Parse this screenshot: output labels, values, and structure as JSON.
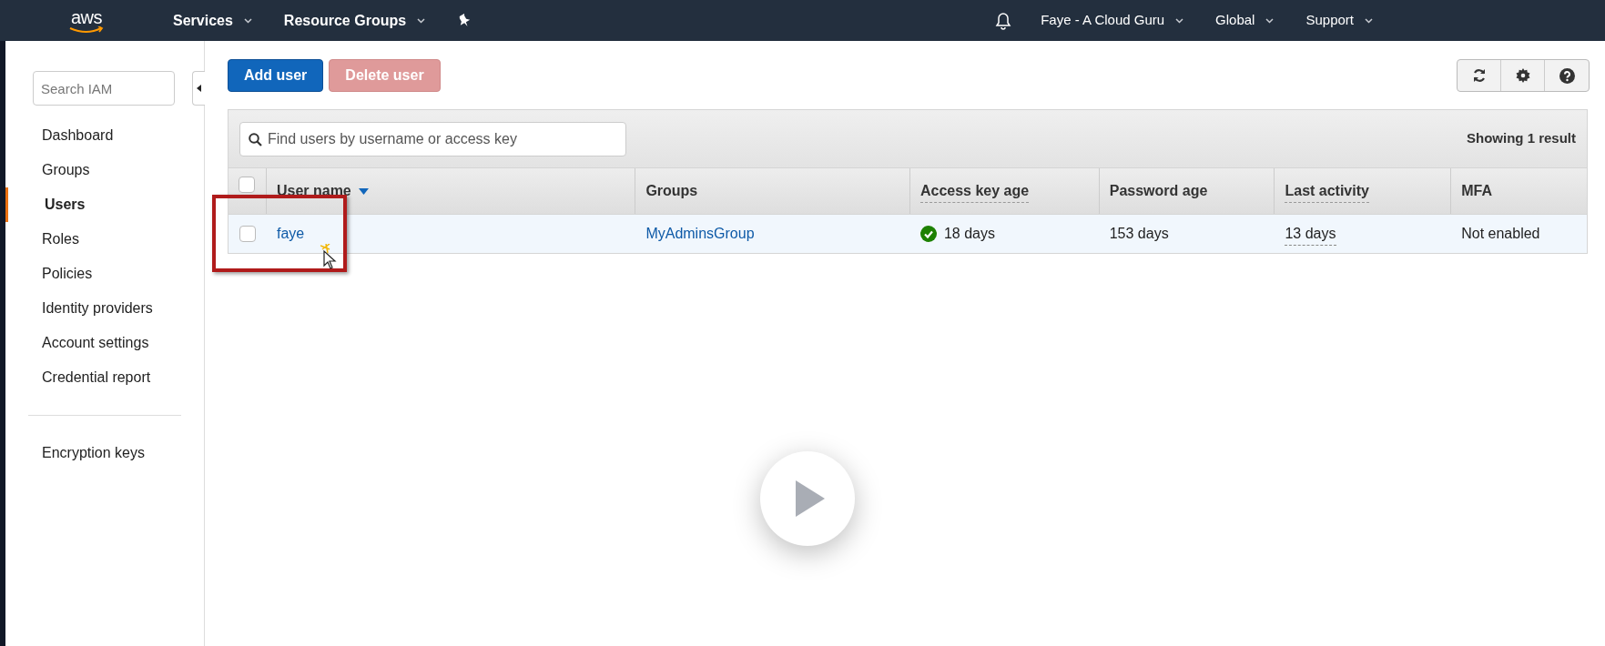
{
  "topbar": {
    "logo": "aws",
    "menus": [
      {
        "label": "Services"
      },
      {
        "label": "Resource Groups"
      }
    ],
    "right_menus": [
      {
        "label": "Faye - A Cloud Guru"
      },
      {
        "label": "Global"
      },
      {
        "label": "Support"
      }
    ]
  },
  "sidebar": {
    "search": {
      "placeholder": "Search IAM"
    },
    "items": [
      {
        "label": "Dashboard",
        "selected": false
      },
      {
        "label": "Groups",
        "selected": false
      },
      {
        "label": "Users",
        "selected": true
      },
      {
        "label": "Roles",
        "selected": false
      },
      {
        "label": "Policies",
        "selected": false
      },
      {
        "label": "Identity providers",
        "selected": false
      },
      {
        "label": "Account settings",
        "selected": false
      },
      {
        "label": "Credential report",
        "selected": false
      }
    ],
    "extra_items": [
      {
        "label": "Encryption keys",
        "selected": false
      }
    ]
  },
  "actions": [
    {
      "label": "Add user",
      "disabled": false
    },
    {
      "label": "Delete user",
      "disabled": true
    }
  ],
  "table": {
    "search": {
      "placeholder": "Find users by username or access key"
    },
    "result_count": "Showing 1 result",
    "all_checked": false,
    "columns": [
      {
        "label": "User name",
        "sorted": true,
        "dotted": false
      },
      {
        "label": "Groups",
        "sorted": false,
        "dotted": false
      },
      {
        "label": "Access key age",
        "sorted": false,
        "dotted": true
      },
      {
        "label": "Password age",
        "sorted": false,
        "dotted": false
      },
      {
        "label": "Last activity",
        "sorted": false,
        "dotted": true
      },
      {
        "label": "MFA",
        "sorted": false,
        "dotted": false
      }
    ],
    "rows": [
      {
        "checked": false,
        "cells": [
          {
            "text": "faye",
            "kind": "link"
          },
          {
            "text": "MyAdminsGroup",
            "kind": "link"
          },
          {
            "text": "18 days",
            "kind": "ok"
          },
          {
            "text": "153 days",
            "kind": "plain"
          },
          {
            "text": "13 days",
            "kind": "dotted"
          },
          {
            "text": "Not enabled",
            "kind": "plain"
          }
        ]
      }
    ]
  }
}
